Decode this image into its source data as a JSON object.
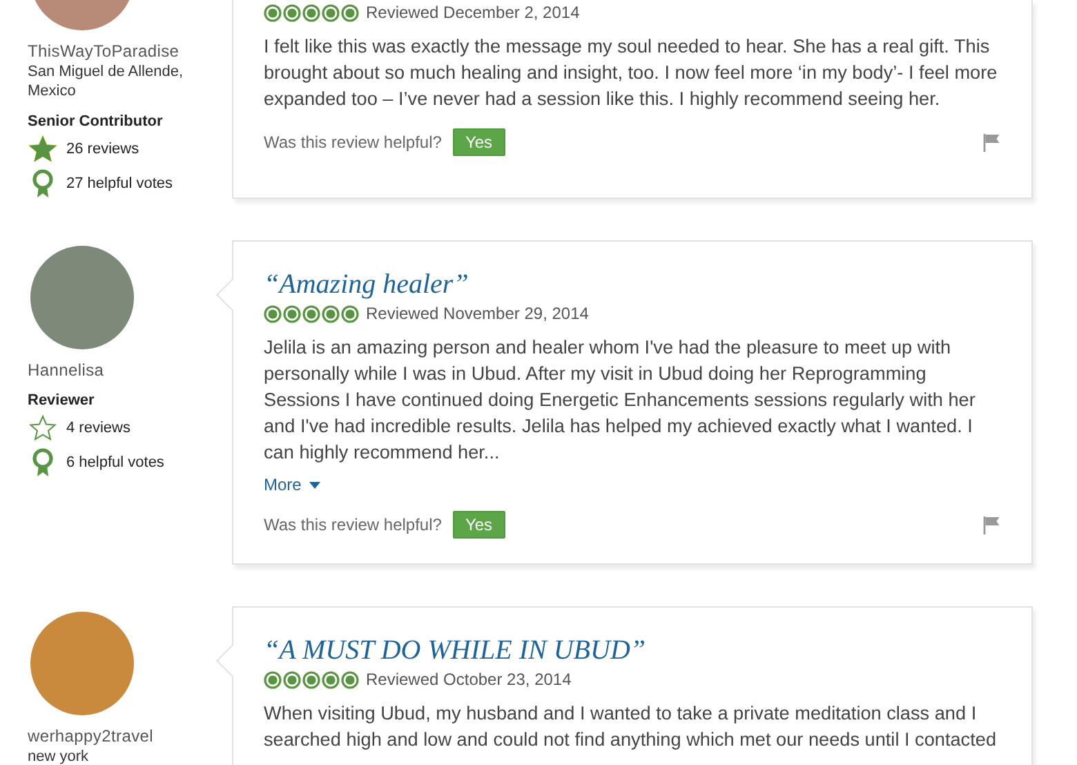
{
  "reviews": [
    {
      "user": {
        "name": "ThisWayToParadise",
        "location": "San Miguel de Allende, Mexico",
        "level": "Senior Contributor",
        "badge_filled": true,
        "reviews": "26 reviews",
        "helpful_votes": "27 helpful votes"
      },
      "stars": 5,
      "date": "Reviewed December 2, 2014",
      "text": "I felt like this was exactly the message my soul needed to hear. She has a real gift. This brought about so much healing and insight, too. I now feel more ‘in my body’- I feel more expanded too – I’ve never had a session like this. I highly recommend seeing her.",
      "helpful_question": "Was this review helpful?",
      "yes": "Yes"
    },
    {
      "user": {
        "name": "Hannelisa",
        "level": "Reviewer",
        "badge_filled": false,
        "reviews": "4 reviews",
        "helpful_votes": "6 helpful votes"
      },
      "title": "“Amazing healer”",
      "stars": 5,
      "date": "Reviewed November 29, 2014",
      "text": "Jelila is an amazing person and healer whom I've had the pleasure to meet up with personally while I was in Ubud. After my visit in Ubud doing her Reprogramming Sessions I have continued doing Energetic Enhancements sessions regularly with her and I've had incredible results. Jelila has helped my achieved exactly what I wanted. I can highly recommend her...",
      "more": "More",
      "helpful_question": "Was this review helpful?",
      "yes": "Yes"
    },
    {
      "user": {
        "name": "werhappy2travel",
        "location": "new york"
      },
      "title": "“A MUST DO WHILE IN UBUD”",
      "stars": 5,
      "date": "Reviewed October 23, 2014",
      "text": "When visiting Ubud, my husband and I wanted to take a private meditation class and I searched high and low and could not find anything which met our needs until I contacted"
    }
  ]
}
